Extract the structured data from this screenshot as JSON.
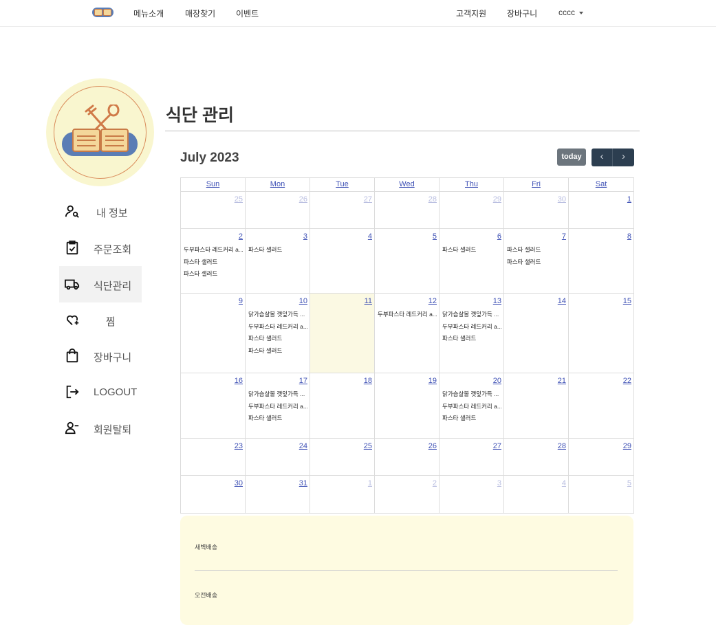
{
  "nav": {
    "left_links": [
      "메뉴소개",
      "매장찾기",
      "이벤트"
    ],
    "right_links": [
      "고객지원",
      "장바구니"
    ],
    "user": "cccc",
    "logo_icon": "dodam-logo-icon"
  },
  "sidebar": {
    "items": [
      {
        "label": "내 정보",
        "icon": "user-search-icon"
      },
      {
        "label": "주문조회",
        "icon": "clipboard-check-icon"
      },
      {
        "label": "식단관리",
        "icon": "truck-icon",
        "active": true
      },
      {
        "label": "찜",
        "icon": "heart-plus-icon"
      },
      {
        "label": "장바구니",
        "icon": "shopping-bag-icon"
      },
      {
        "label": "LOGOUT",
        "icon": "logout-icon"
      },
      {
        "label": "회원탈퇴",
        "icon": "user-minus-icon"
      }
    ]
  },
  "page_title": "식단 관리",
  "calendar": {
    "title": "July 2023",
    "today_label": "today",
    "prev_label": "‹",
    "next_label": "›",
    "weekdays": [
      "Sun",
      "Mon",
      "Tue",
      "Wed",
      "Thu",
      "Fri",
      "Sat"
    ],
    "today_date": "11",
    "weeks": [
      [
        {
          "d": "25",
          "o": true,
          "e": []
        },
        {
          "d": "26",
          "o": true,
          "e": []
        },
        {
          "d": "27",
          "o": true,
          "e": []
        },
        {
          "d": "28",
          "o": true,
          "e": []
        },
        {
          "d": "29",
          "o": true,
          "e": []
        },
        {
          "d": "30",
          "o": true,
          "e": []
        },
        {
          "d": "1",
          "e": []
        }
      ],
      [
        {
          "d": "2",
          "e": [
            "두부파스타 레드커리 a...",
            "파스타 샐러드",
            "파스타 샐러드"
          ]
        },
        {
          "d": "3",
          "e": [
            "파스타 샐러드"
          ]
        },
        {
          "d": "4",
          "e": []
        },
        {
          "d": "5",
          "e": []
        },
        {
          "d": "6",
          "e": [
            "파스타 샐러드"
          ]
        },
        {
          "d": "7",
          "e": [
            "파스타 샐러드",
            "파스타 샐러드"
          ]
        },
        {
          "d": "8",
          "e": []
        }
      ],
      [
        {
          "d": "9",
          "e": []
        },
        {
          "d": "10",
          "e": [
            "닭가슴살볼 깻잎가득 ...",
            "두부파스타 레드커리 a...",
            "파스타 샐러드",
            "파스타 샐러드"
          ]
        },
        {
          "d": "11",
          "e": []
        },
        {
          "d": "12",
          "e": [
            "두부파스타 레드커리 a..."
          ]
        },
        {
          "d": "13",
          "e": [
            "닭가슴살볼 깻잎가득 ...",
            "두부파스타 레드커리 a...",
            "파스타 샐러드"
          ]
        },
        {
          "d": "14",
          "e": []
        },
        {
          "d": "15",
          "e": []
        }
      ],
      [
        {
          "d": "16",
          "e": []
        },
        {
          "d": "17",
          "e": [
            "닭가슴살볼 깻잎가득 ...",
            "두부파스타 레드커리 a...",
            "파스타 샐러드"
          ]
        },
        {
          "d": "18",
          "e": []
        },
        {
          "d": "19",
          "e": []
        },
        {
          "d": "20",
          "e": [
            "닭가슴살볼 깻잎가득 ...",
            "두부파스타 레드커리 a...",
            "파스타 샐러드"
          ]
        },
        {
          "d": "21",
          "e": []
        },
        {
          "d": "22",
          "e": []
        }
      ],
      [
        {
          "d": "23",
          "e": []
        },
        {
          "d": "24",
          "e": []
        },
        {
          "d": "25",
          "e": []
        },
        {
          "d": "26",
          "e": []
        },
        {
          "d": "27",
          "e": []
        },
        {
          "d": "28",
          "e": []
        },
        {
          "d": "29",
          "e": []
        }
      ],
      [
        {
          "d": "30",
          "e": []
        },
        {
          "d": "31",
          "e": []
        },
        {
          "d": "1",
          "o": true,
          "e": []
        },
        {
          "d": "2",
          "o": true,
          "e": []
        },
        {
          "d": "3",
          "o": true,
          "e": []
        },
        {
          "d": "4",
          "o": true,
          "e": []
        },
        {
          "d": "5",
          "o": true,
          "e": []
        }
      ]
    ]
  },
  "delivery": {
    "dawn_label": "새벽배송",
    "morning_label": "오전배송"
  },
  "colors": {
    "accent_blue": "#3f51b5",
    "today_bg": "#fbf9e3",
    "nav_button": "#2c3e50",
    "today_button": "#6c757d",
    "panel_bg": "#fefbe1",
    "profile_bg": "#f9f6cf"
  }
}
